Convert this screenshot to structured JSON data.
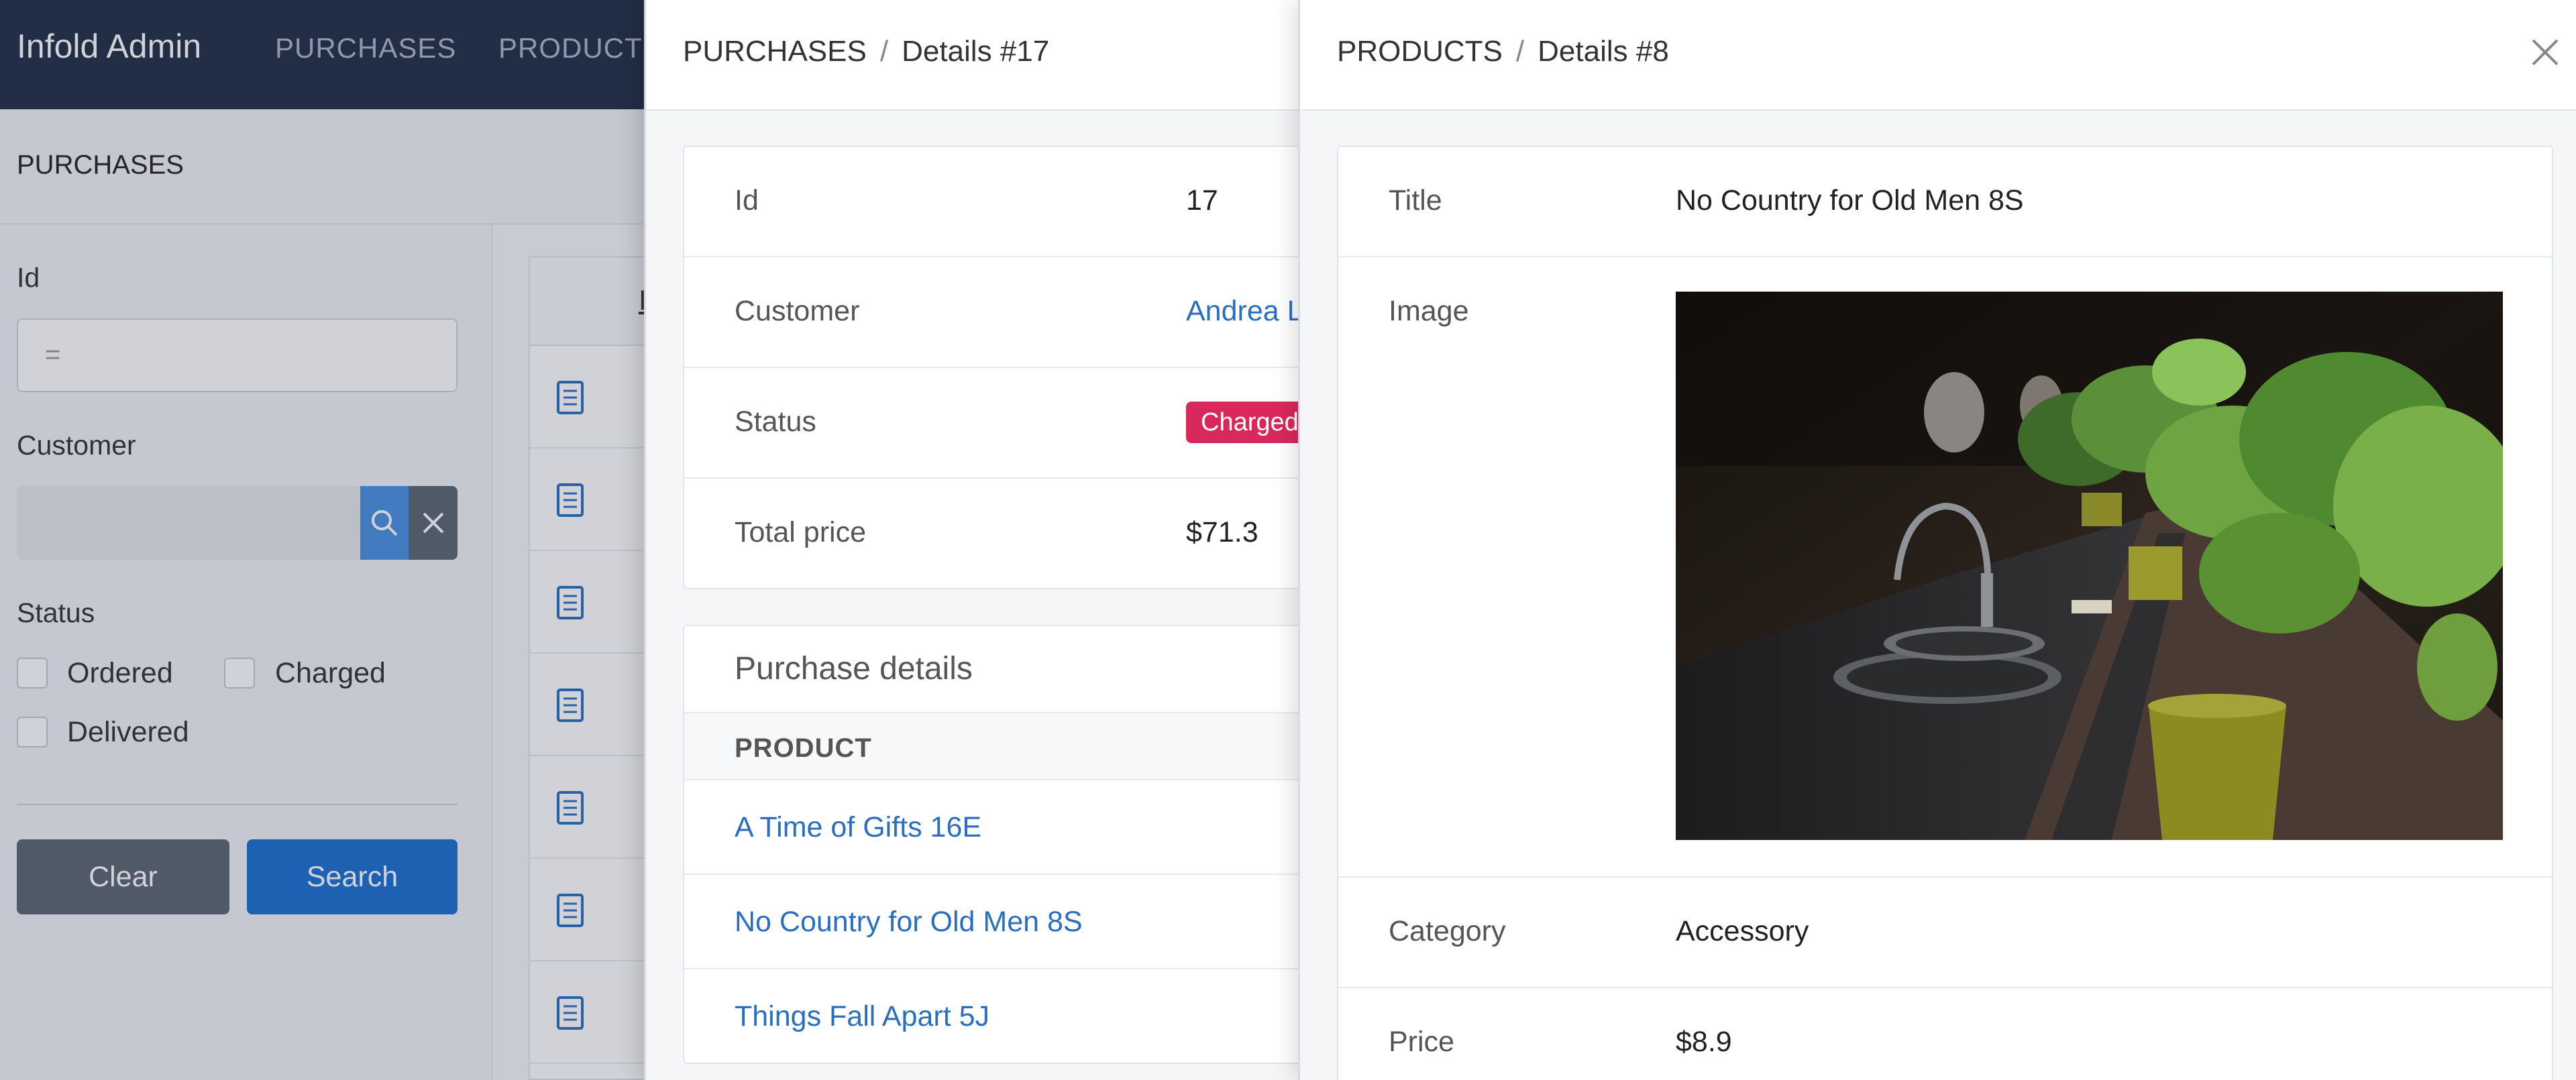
{
  "app": {
    "brand": "Infold Admin",
    "nav": [
      "PURCHASES",
      "PRODUCTS"
    ]
  },
  "page": {
    "title": "PURCHASES"
  },
  "filters": {
    "id_label": "Id",
    "id_placeholder": "=",
    "customer_label": "Customer",
    "status_label": "Status",
    "status_options": [
      "Ordered",
      "Charged",
      "Delivered"
    ],
    "clear_label": "Clear",
    "search_label": "Search"
  },
  "list": {
    "header_id": "I"
  },
  "purchase": {
    "breadcrumb": [
      "PURCHASES",
      "Details #17"
    ],
    "fields": [
      {
        "key": "Id",
        "value": "17"
      },
      {
        "key": "Customer",
        "value": "Andrea L"
      },
      {
        "key": "Status",
        "value": "Charged"
      },
      {
        "key": "Total price",
        "value": "$71.3"
      }
    ],
    "details_title": "Purchase details",
    "details_header": "PRODUCT",
    "details_rows": [
      "A Time of Gifts 16E",
      "No Country for Old Men 8S",
      "Things Fall Apart 5J"
    ]
  },
  "product": {
    "breadcrumb": [
      "PRODUCTS",
      "Details #8"
    ],
    "title_label": "Title",
    "title_value": "No Country for Old Men 8S",
    "image_label": "Image",
    "category_label": "Category",
    "category_value": "Accessory",
    "price_label": "Price",
    "price_value": "$8.9"
  },
  "colors": {
    "topbar": "#1f2d44",
    "link": "#2a6fbf",
    "badge_charged": "#d9285c",
    "primary_button": "#1a6fd1"
  }
}
